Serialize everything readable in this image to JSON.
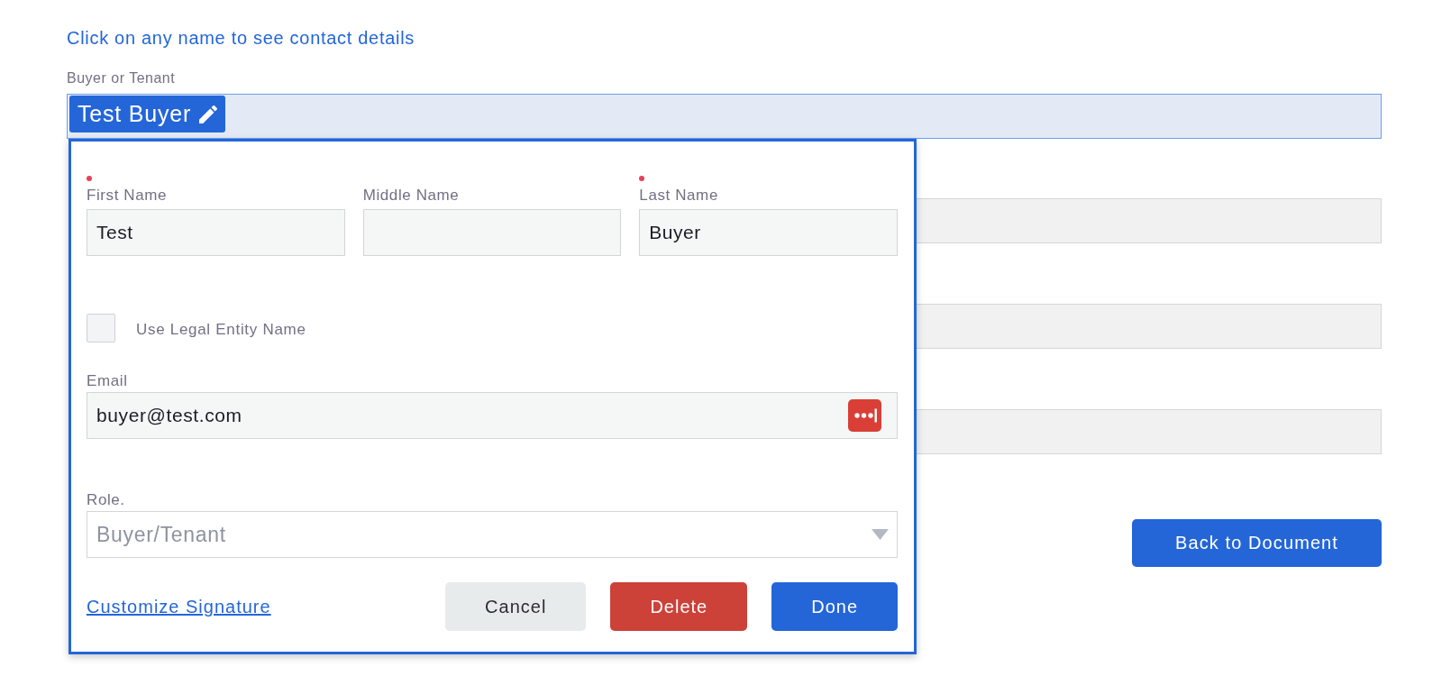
{
  "heading": {
    "text": "Click on any name to see contact details"
  },
  "party": {
    "label": "Buyer or Tenant",
    "tags": [
      {
        "text": "Test Buyer"
      }
    ]
  },
  "editor": {
    "name_fields": [
      {
        "label": "First Name",
        "required": true,
        "value": "Test"
      },
      {
        "label": "Middle Name",
        "required": false
      },
      {
        "label": "Last Name",
        "required": true,
        "value": "Buyer"
      }
    ],
    "legal_entity": {
      "label": "Use Legal Entity Name",
      "checked": false
    },
    "email": {
      "label": "Email",
      "value": "buyer@test.com"
    },
    "role": {
      "label": "Role.",
      "value": "Buyer/Tenant",
      "disabled": true
    },
    "signature_link": {
      "text": "Customize Signature"
    },
    "buttons": [
      {
        "label": "Cancel",
        "kind": "secondary"
      },
      {
        "label": "Delete",
        "kind": "danger"
      },
      {
        "label": "Done",
        "kind": "primary"
      }
    ]
  },
  "back_button": {
    "label": "Back to Document"
  }
}
